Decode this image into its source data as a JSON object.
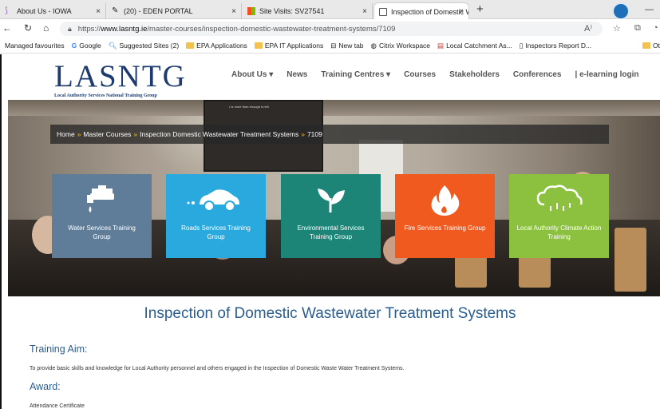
{
  "browser": {
    "tabs": [
      {
        "title": "About Us - IOWA",
        "active": false
      },
      {
        "title": "(20) - EDEN PORTAL",
        "active": false
      },
      {
        "title": "Site Visits: SV27541",
        "active": false
      },
      {
        "title": "Inspection of Domestic Wastewa",
        "active": true
      }
    ],
    "new_tab": "+",
    "close": "×",
    "minimize": "—",
    "url": {
      "prefix": "https://",
      "domain": "www.lasntg.ie",
      "path": "/master-courses/inspection-domestic-wastewater-treatment-systems/7109"
    },
    "favorites_label": "Managed favourites",
    "favorites": [
      {
        "label": "Google",
        "icon": "google-icon"
      },
      {
        "label": "Suggested Sites (2)",
        "icon": "search-icon"
      },
      {
        "label": "EPA Applications",
        "icon": "folder-icon"
      },
      {
        "label": "EPA IT Applications",
        "icon": "folder-icon"
      },
      {
        "label": "New tab",
        "icon": "newtab-icon"
      },
      {
        "label": "Citrix Workspace",
        "icon": "citrix-icon"
      },
      {
        "label": "Local Catchment As...",
        "icon": "page-icon"
      },
      {
        "label": "Inspectors Report D...",
        "icon": "page-icon"
      }
    ],
    "other_favorites": "Ot"
  },
  "site": {
    "logo": "LASNTG",
    "logo_sub": "Local Authority Services National Training Group",
    "nav": [
      "About Us ▾",
      "News",
      "Training Centres ▾",
      "Courses",
      "Stakeholders",
      "Conferences",
      "| e-learning login"
    ]
  },
  "hero": {
    "screen_text": "• is more than enough to tell",
    "breadcrumb": [
      "Home",
      "Master Courses",
      "Inspection Domestic Wastewater Treatment Systems",
      "7109"
    ],
    "breadcrumb_sep": "»",
    "tiles": [
      {
        "label": "Water Services Training Group",
        "color": "#5f7d99",
        "icon": "water-tap-icon"
      },
      {
        "label": "Roads Services Training Group",
        "color": "#2aa9df",
        "icon": "car-icon"
      },
      {
        "label": "Environmental Services Training Group",
        "color": "#1c8578",
        "icon": "leaves-icon"
      },
      {
        "label": "Fire Services Training Group",
        "color": "#f05a1e",
        "icon": "fire-icon"
      },
      {
        "label": "Local Authority Climate Action Training",
        "color": "#8cc13f",
        "icon": "cloud-rain-icon"
      }
    ]
  },
  "content": {
    "title": "Inspection of Domestic Wastewater Treatment Systems",
    "aim_heading": "Training Aim:",
    "aim_text": "To provide basic skills and knowledge for Local Authority personnel and others engaged in the Inspection of Domestic Waste Water Treatment Systems.",
    "award_heading": "Award:",
    "award_text": "Attendance Certificate"
  }
}
